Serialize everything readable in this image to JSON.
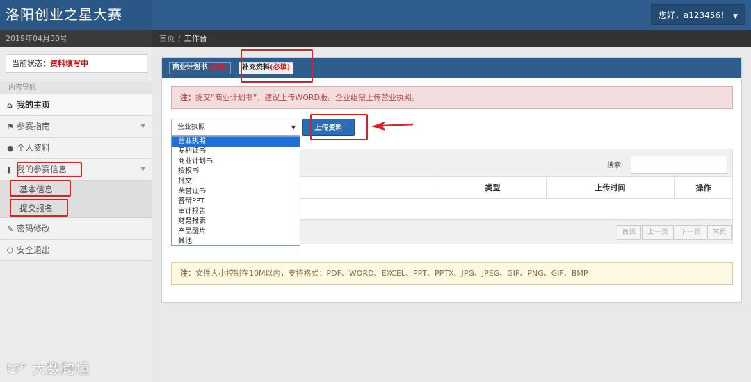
{
  "app": {
    "title": "洛阳创业之星大赛"
  },
  "user": {
    "greeting": "您好，a123456！"
  },
  "date": "2019年04月30号",
  "breadcrumb": {
    "home": "首页",
    "sep": "/",
    "current": "工作台"
  },
  "sidebar": {
    "status_label": "当前状态：",
    "status_value": "资料填写中",
    "nav_title": "内容导航",
    "items": [
      {
        "label": "我的主页",
        "icon": "home-icon"
      },
      {
        "label": "参赛指南",
        "icon": "flag-icon"
      },
      {
        "label": "个人资料",
        "icon": "user-icon"
      },
      {
        "label": "我的参赛信息",
        "icon": "file-icon"
      },
      {
        "label": "密码修改",
        "icon": "wrench-icon"
      },
      {
        "label": "安全退出",
        "icon": "power-icon"
      }
    ],
    "sub_items": [
      {
        "label": "基本信息"
      },
      {
        "label": "提交报名"
      }
    ]
  },
  "main": {
    "tabs": [
      {
        "label": "商业计划书",
        "required": "(必填)"
      },
      {
        "label": "补充资料",
        "required": "(必填)"
      }
    ],
    "notice": {
      "prefix": "注：",
      "text": "提交“商业计划书”，建议上传WORD版。企业组需上传营业执照。"
    },
    "select": {
      "value": "营业执照",
      "options": [
        "营业执照",
        "专利证书",
        "商业计划书",
        "授权书",
        "批文",
        "荣誉证书",
        "答辩PPT",
        "审计报告",
        "财务报表",
        "产品图片",
        "其他"
      ]
    },
    "upload_button": "上传资料",
    "table": {
      "search_label": "搜索:",
      "columns": [
        "类型",
        "上传时间",
        "操作"
      ],
      "pager": [
        "首页",
        "上一页",
        "下一页",
        "末页"
      ]
    },
    "footer_note": {
      "prefix": "注：",
      "text": "文件大小控制在10M以内，支持格式：PDF、WORD、EXCEL、PPT、PPTX、JPG、JPEG、GIF、PNG、GIF、BMP"
    }
  },
  "watermark": "大数跨境",
  "colors": {
    "primary": "#2f5d8e",
    "highlight": "#e02020",
    "selected": "#1e6fd9"
  }
}
